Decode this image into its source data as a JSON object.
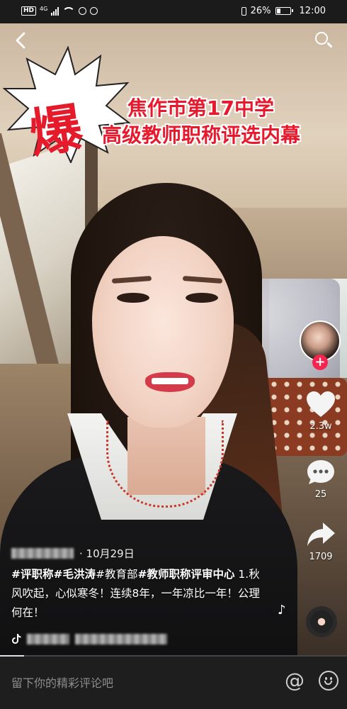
{
  "status_bar": {
    "hd": "HD",
    "network": "4G",
    "battery_percent": "26%",
    "battery_level": 0.26,
    "time": "12:00"
  },
  "nav": {
    "back_icon": "‹",
    "search_icon": "search-icon"
  },
  "sticker": {
    "burst_char": "爆",
    "burst_color": "#e51a2b"
  },
  "headline": {
    "line1": "焦作市第17中学",
    "line2": "高级教师职称评选内幕",
    "color": "#e8192c"
  },
  "rail": {
    "follow_label": "+",
    "like_count": "2.3w",
    "comment_count": "25",
    "share_count": "1709",
    "music_note": "♪"
  },
  "post": {
    "date": "· 10月29日",
    "hashtags": "#评职称#毛洪涛#教育部#教师职称评审中心",
    "tag1": "#评职称",
    "tag2": "#毛洪涛",
    "tag3": "#教育部",
    "tag4": "#教师职称评审中心",
    "body": " 1.秋风吹起，心似寒冬！连续8年，一年凉比一年！公理何在！"
  },
  "comment": {
    "placeholder": "留下你的精彩评论吧",
    "at_label": "@"
  },
  "progress": {
    "played_fraction": 0.07
  }
}
